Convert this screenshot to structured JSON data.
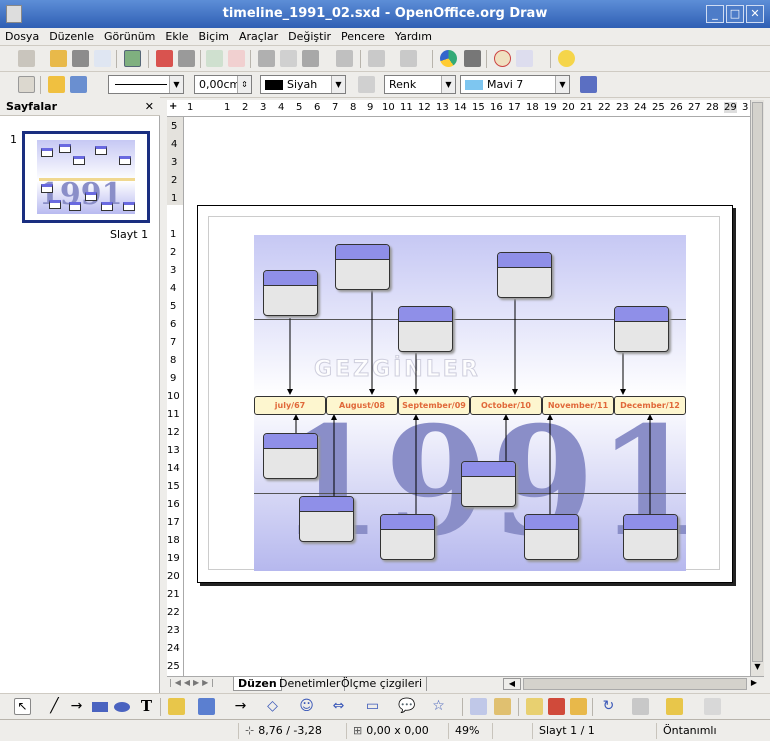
{
  "window": {
    "title": "timeline_1991_02.sxd - OpenOffice.org Draw",
    "min": "_",
    "max": "□",
    "close": "✕"
  },
  "menu": [
    "Dosya",
    "Düzenle",
    "Görünüm",
    "Ekle",
    "Biçim",
    "Araçlar",
    "Değiştir",
    "Pencere",
    "Yardım"
  ],
  "line_toolbar": {
    "width_value": "0,00cm",
    "line_color": "Siyah",
    "area_style": "Renk",
    "area_color": "Mavi 7"
  },
  "pages_panel": {
    "title": "Sayfalar",
    "close": "✕",
    "page_number": "1",
    "slide_label": "Slayt 1"
  },
  "ruler_h": [
    "1",
    "1",
    "2",
    "3",
    "4",
    "5",
    "6",
    "7",
    "8",
    "9",
    "10",
    "11",
    "12",
    "13",
    "14",
    "15",
    "16",
    "17",
    "18",
    "19",
    "20",
    "21",
    "22",
    "23",
    "24",
    "25",
    "26",
    "27",
    "28",
    "29",
    "3"
  ],
  "ruler_v_top": [
    "5",
    "4",
    "3",
    "2",
    "1"
  ],
  "ruler_v": [
    "1",
    "2",
    "3",
    "4",
    "5",
    "6",
    "7",
    "8",
    "9",
    "10",
    "11",
    "12",
    "13",
    "14",
    "15",
    "16",
    "17",
    "18",
    "19",
    "20",
    "21",
    "22",
    "23",
    "24",
    "25"
  ],
  "slide": {
    "year": "1991",
    "watermark": "GEZGİNLER",
    "dates": [
      "july/67",
      "August/08",
      "September/09",
      "October/10",
      "November/11",
      "December/12"
    ]
  },
  "tabs": [
    "Düzen",
    "Denetimler",
    "Ölçme çizgileri"
  ],
  "status": {
    "position": "8,76 / -3,28",
    "size": "0,00 x 0,00",
    "zoom": "49%",
    "page": "Slayt 1 / 1",
    "layout": "Öntanımlı"
  },
  "colors": {
    "title_bar": "#3a6cc0",
    "box_header": "#8f8fe8",
    "box_body": "#e6e6e6",
    "date_fill": "#fdf6cf",
    "date_text": "#e0683a",
    "year": "#8a8ec8"
  }
}
